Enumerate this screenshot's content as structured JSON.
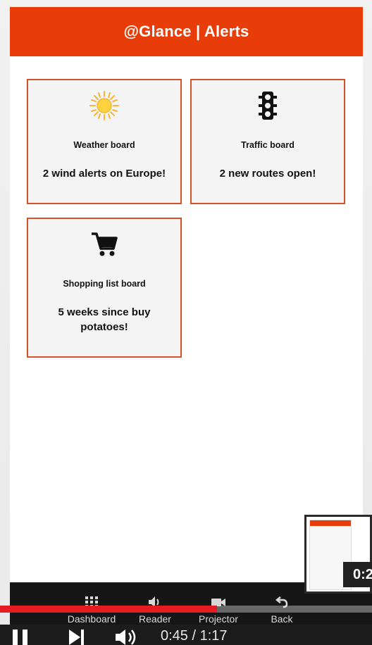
{
  "header": {
    "title": "@Glance | Alerts"
  },
  "cards": [
    {
      "id": "weather",
      "title": "Weather board",
      "message": "2 wind alerts on Europe!",
      "icon": "sun-icon"
    },
    {
      "id": "traffic",
      "title": "Traffic board",
      "message": "2 new routes open!",
      "icon": "traffic-light-icon"
    },
    {
      "id": "shopping",
      "title": "Shopping list board",
      "message": "5 weeks since buy potatoes!",
      "icon": "shopping-cart-icon"
    }
  ],
  "nav": {
    "items": [
      {
        "label": "Dashboard",
        "icon": "grid-icon"
      },
      {
        "label": "Reader",
        "icon": "speaker-icon"
      },
      {
        "label": "Projector",
        "icon": "camera-icon"
      },
      {
        "label": "Back",
        "icon": "back-arrow-icon"
      }
    ]
  },
  "video": {
    "time": "0:45 / 1:17",
    "progress": 0.584,
    "preview_time": "0:2"
  },
  "colors": {
    "accent": "#e83d08",
    "card_border": "#d2522a",
    "progress": "#e51c23"
  }
}
